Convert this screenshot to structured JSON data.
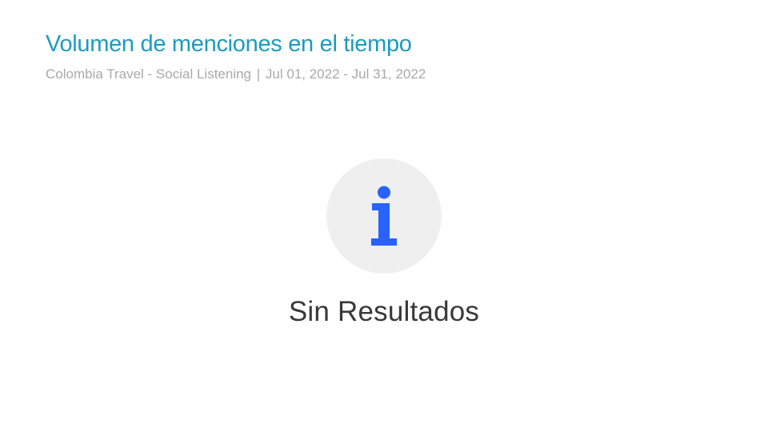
{
  "header": {
    "title": "Volumen de menciones en el tiempo",
    "subtitle_source": "Colombia Travel - Social Listening",
    "subtitle_separator": "|",
    "subtitle_range": "Jul 01, 2022 - Jul 31, 2022"
  },
  "empty_state": {
    "icon": "info-icon",
    "message": "Sin Resultados"
  },
  "colors": {
    "title": "#1c9bbf",
    "subtitle": "#a9a9a9",
    "icon": "#2962ff",
    "icon_background": "#efefef",
    "message": "#383838"
  }
}
